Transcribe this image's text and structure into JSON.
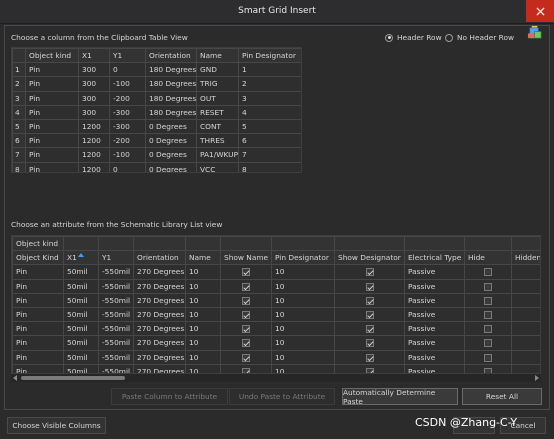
{
  "window": {
    "title": "Smart Grid Insert"
  },
  "top_section": {
    "label": "Choose a column from the Clipboard Table View",
    "radio_header_row": "Header Row",
    "radio_no_header_row": "No Header Row",
    "header_row_selected": true
  },
  "clipboard_table": {
    "columns": [
      "Object kind",
      "X1",
      "Y1",
      "Orientation",
      "Name",
      "Pin Designator"
    ],
    "rows": [
      {
        "num": "1",
        "cells": [
          "Pin",
          "300",
          "0",
          "180 Degrees",
          "GND",
          "1"
        ]
      },
      {
        "num": "2",
        "cells": [
          "Pin",
          "300",
          "-100",
          "180 Degrees",
          "TRIG",
          "2"
        ]
      },
      {
        "num": "3",
        "cells": [
          "Pin",
          "300",
          "-200",
          "180 Degrees",
          "OUT",
          "3"
        ]
      },
      {
        "num": "4",
        "cells": [
          "Pin",
          "300",
          "-300",
          "180 Degrees",
          "RESET",
          "4"
        ]
      },
      {
        "num": "5",
        "cells": [
          "Pin",
          "1200",
          "-300",
          "0 Degrees",
          "CONT",
          "5"
        ]
      },
      {
        "num": "6",
        "cells": [
          "Pin",
          "1200",
          "-200",
          "0 Degrees",
          "THRES",
          "6"
        ]
      },
      {
        "num": "7",
        "cells": [
          "Pin",
          "1200",
          "-100",
          "0 Degrees",
          "PA1/WKUP",
          "7"
        ]
      },
      {
        "num": "8",
        "cells": [
          "Pin",
          "1200",
          "0",
          "0 Degrees",
          "VCC",
          "8"
        ]
      }
    ]
  },
  "bottom_section": {
    "label": "Choose an attribute from the Schematic Library List view"
  },
  "library_table": {
    "group_header": "Object kind",
    "columns": [
      "Object Kind",
      "X1",
      "Y1",
      "Orientation",
      "Name",
      "Show Name",
      "Pin Designator",
      "Show Designator",
      "Electrical Type",
      "Hide",
      "Hidden Net N"
    ],
    "rows": [
      {
        "kind": "Pin",
        "x1": "50mil",
        "y1": "-550mil",
        "orientation": "270 Degrees",
        "name": "10",
        "show_name": true,
        "designator": "10",
        "show_designator": true,
        "etype": "Passive",
        "hide": false
      },
      {
        "kind": "Pin",
        "x1": "50mil",
        "y1": "-550mil",
        "orientation": "270 Degrees",
        "name": "10",
        "show_name": true,
        "designator": "10",
        "show_designator": true,
        "etype": "Passive",
        "hide": false
      },
      {
        "kind": "Pin",
        "x1": "50mil",
        "y1": "-550mil",
        "orientation": "270 Degrees",
        "name": "10",
        "show_name": true,
        "designator": "10",
        "show_designator": true,
        "etype": "Passive",
        "hide": false
      },
      {
        "kind": "Pin",
        "x1": "50mil",
        "y1": "-550mil",
        "orientation": "270 Degrees",
        "name": "10",
        "show_name": true,
        "designator": "10",
        "show_designator": true,
        "etype": "Passive",
        "hide": false
      },
      {
        "kind": "Pin",
        "x1": "50mil",
        "y1": "-550mil",
        "orientation": "270 Degrees",
        "name": "10",
        "show_name": true,
        "designator": "10",
        "show_designator": true,
        "etype": "Passive",
        "hide": false
      },
      {
        "kind": "Pin",
        "x1": "50mil",
        "y1": "-550mil",
        "orientation": "270 Degrees",
        "name": "10",
        "show_name": true,
        "designator": "10",
        "show_designator": true,
        "etype": "Passive",
        "hide": false
      },
      {
        "kind": "Pin",
        "x1": "50mil",
        "y1": "-550mil",
        "orientation": "270 Degrees",
        "name": "10",
        "show_name": true,
        "designator": "10",
        "show_designator": true,
        "etype": "Passive",
        "hide": false
      },
      {
        "kind": "Pin",
        "x1": "50mil",
        "y1": "-550mil",
        "orientation": "270 Degrees",
        "name": "10",
        "show_name": true,
        "designator": "10",
        "show_designator": true,
        "etype": "Passive",
        "hide": false
      }
    ]
  },
  "buttons": {
    "paste_column": "Paste Column to Attribute",
    "undo_paste": "Undo Paste to Attribute",
    "auto_determine": "Automatically Determine Paste",
    "reset_all": "Reset All",
    "choose_visible": "Choose Visible Columns",
    "cancel": "Cancel"
  },
  "watermark": "CSDN @Zhang-C-Y",
  "icons": {
    "close": "close-icon",
    "paste": "clipboard-paste-icon",
    "sort": "sort-ascending-icon"
  }
}
